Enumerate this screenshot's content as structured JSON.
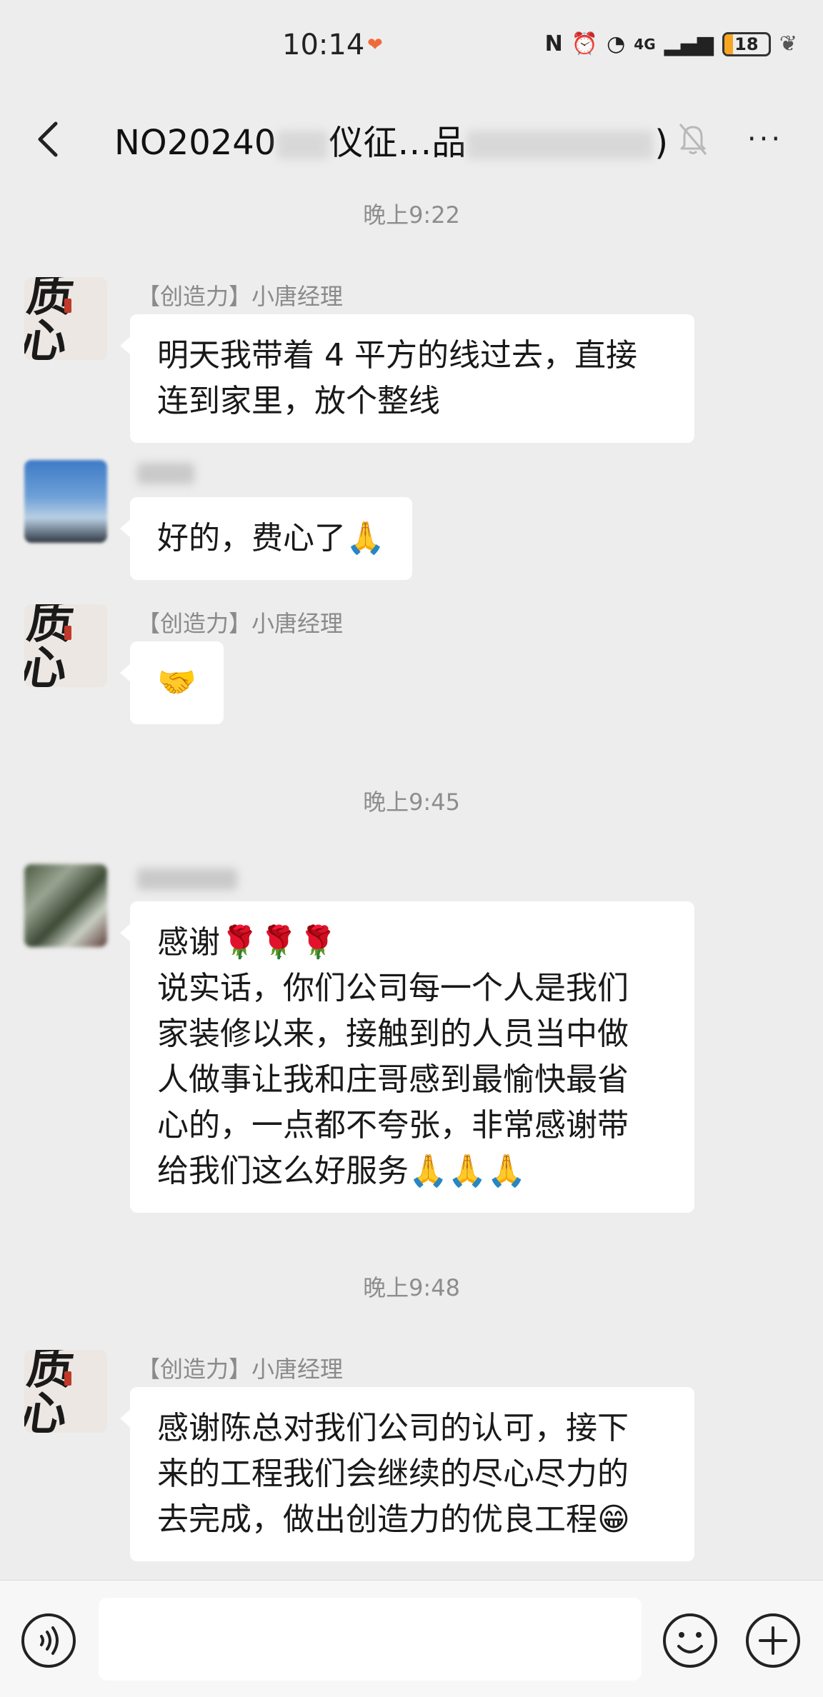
{
  "status_bar": {
    "time": "10:14",
    "heart": "❤",
    "nfc": "N",
    "alarm": "⏰",
    "wifi": "◔",
    "signal": "4G",
    "bars": "▂▄▆",
    "battery": "18",
    "leaf": "❦"
  },
  "nav": {
    "back_icon": "chevron-left-icon",
    "title_prefix": "NO20240",
    "title_mid": "仪征…品",
    "title_suffix": ")",
    "mute_icon": "bell-off-icon",
    "more_label": "···"
  },
  "chat": {
    "time_1": "晚上9:22",
    "time_2": "晚上9:45",
    "time_3": "晚上9:48",
    "messages": [
      {
        "sender": "【创造力】小唐经理",
        "text": "明天我带着 4 平方的线过去，直接\n连到家里，放个整线"
      },
      {
        "sender": "",
        "text": "好的，费心了🙏"
      },
      {
        "sender": "【创造力】小唐经理",
        "text": "🤝"
      },
      {
        "sender": "",
        "text": "感谢🌹🌹🌹\n说实话，你们公司每一个人是我们\n家装修以来，接触到的人员当中做\n人做事让我和庄哥感到最愉快最省\n心的，一点都不夸张，非常感谢带\n给我们这么好服务🙏🙏🙏"
      },
      {
        "sender": "【创造力】小唐经理",
        "text": "感谢陈总对我们公司的认可，接下\n来的工程我们会继续的尽心尽力的\n去完成，做出创造力的优良工程😁"
      }
    ],
    "brand_avatar_mark": "质心"
  },
  "input_bar": {
    "voice_icon": "voice-icon",
    "emoji_icon": "emoji-icon",
    "plus_icon": "plus-icon",
    "input_value": ""
  },
  "colors": {
    "background": "#ededed",
    "bubble": "#ffffff",
    "meta_text": "#8d8d8d"
  }
}
